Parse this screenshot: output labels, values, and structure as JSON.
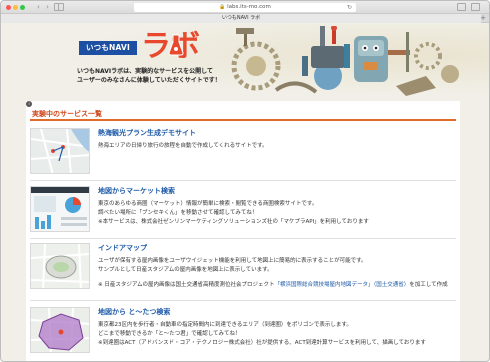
{
  "browser": {
    "address": "labs.its-mo.com",
    "tab_title": "いつもNAVI ラボ",
    "reload_symbol": "↻",
    "back_symbol": "‹",
    "forward_symbol": "›",
    "new_tab_symbol": "+"
  },
  "header": {
    "logo_text": "いつもNAVI",
    "labo_text": "ラボ",
    "tagline_line1": "いつもNAVIラボは、実験的なサービスを公開して",
    "tagline_line2": "ユーザーのみなさんに体験していただくサイトです！"
  },
  "section": {
    "title": "実験中のサービス一覧"
  },
  "entries": [
    {
      "title": "熱海観光プラン生成デモサイト",
      "lines": [
        "熱海エリアの日帰り旅行の旅程を自動で作成してくれるサイトです。"
      ]
    },
    {
      "title": "地図からマーケット検索",
      "lines": [
        "東京のあらゆる商圏（マーケット）情報が簡単に検索・閲覧できる商圏検索サイトです。",
        "調べたい場所に「ブンセキくん」を移動させて確認してみてね！",
        "※本サービスは、株式会社ゼンリンマーケティングソリューションズ社の「マケプラAPI」を利用しております"
      ]
    },
    {
      "title": "インドアマップ",
      "lines": [
        "ユーザが保有する屋内画像をユーザウイジェット機能を利用して地図上に簡易的に表示することが可能です。",
        "サンプルとして日産スタジアムの屋内画像を地図上に表示しています。",
        "",
        "※ 日産スタジアムの屋内画像は国土交通省高精度測位社会プロジェクト"
      ],
      "link_text": "「横浜国際総合競技場屋内地図データ」",
      "link_suffix": "（国土交通省）",
      "tail_text": "を加工して作成"
    },
    {
      "title": "地図から と～たつ検索",
      "lines": [
        "東京都23区内を歩行者・自動車の指定時間内に到達できるエリア（到達圏）をポリゴンで表示します。",
        "どこまで移動できるか「と～たつ君」で確認してみてね！",
        "※到達圏はACT（アドバンスド・コア・テクノロジー株式会社）社が提供する、ACT到達計算サービスを利用して、描画しております"
      ]
    }
  ],
  "colors": {
    "accent_orange": "#e36b2a",
    "link_blue": "#1e5aa8",
    "brand_blue": "#1d4fa3",
    "labo_red": "#e8482e"
  }
}
